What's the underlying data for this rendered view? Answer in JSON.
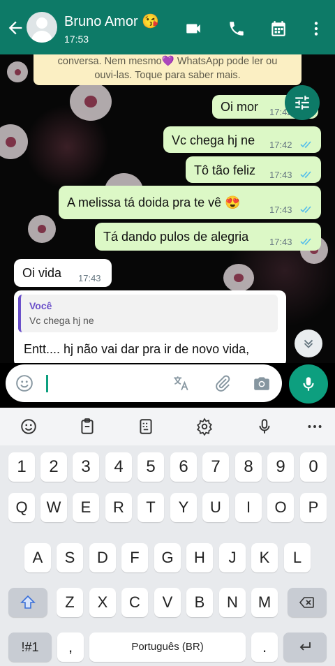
{
  "header": {
    "name": "Bruno Amor",
    "name_emoji": "😘",
    "time": "17:53"
  },
  "notice": {
    "line1": "conversa. Nem mesmo💜 WhatsApp pode ler ou",
    "line2": "ouvi-las. Toque para saber mais."
  },
  "messages": [
    {
      "text": "Oi mor",
      "time": "17:42"
    },
    {
      "text": "Vc chega hj ne",
      "time": "17:42"
    },
    {
      "text": "Tô tão feliz",
      "time": "17:43"
    },
    {
      "text": "A melissa tá doida pra te vê 😍",
      "time": "17:43"
    },
    {
      "text": "Tá dando pulos de alegria",
      "time": "17:43"
    },
    {
      "text": "Oi vida",
      "time": "17:43"
    }
  ],
  "reply": {
    "quoted_author": "Você",
    "quoted_text": "Vc chega hj ne",
    "body": "Entt.... hj não vai dar pra ir de novo vida,"
  },
  "keyboard": {
    "numbers": [
      "1",
      "2",
      "3",
      "4",
      "5",
      "6",
      "7",
      "8",
      "9",
      "0"
    ],
    "row1": [
      "Q",
      "W",
      "E",
      "R",
      "T",
      "Y",
      "U",
      "I",
      "O",
      "P"
    ],
    "row2": [
      "A",
      "S",
      "D",
      "F",
      "G",
      "H",
      "J",
      "K",
      "L"
    ],
    "row3": [
      "Z",
      "X",
      "C",
      "V",
      "B",
      "N",
      "M"
    ],
    "symbols_label": "!#1",
    "comma": ",",
    "space_label": "Português (BR)",
    "period": "."
  },
  "colors": {
    "header": "#0d7a67",
    "outgoing": "#dcf8c6",
    "incoming": "#ffffff",
    "accent": "#0d9f7f"
  }
}
